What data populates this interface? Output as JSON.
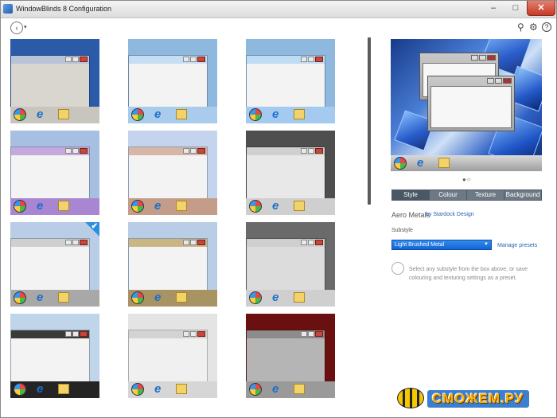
{
  "window": {
    "title": "WindowBlinds 8 Configuration",
    "min_glyph": "–",
    "max_glyph": "□",
    "close_glyph": "✕"
  },
  "toolbar": {
    "back_glyph": "‹",
    "back_caret": "▾",
    "search_glyph": "⚲",
    "settings_glyph": "⚙",
    "help_glyph": "?"
  },
  "skins": [
    {
      "name": "classic-blue",
      "cap": "#b7c3d6",
      "client": "#d9d6cf",
      "bg": "#2a5aa8",
      "bar": "#c8c5be",
      "selected": false
    },
    {
      "name": "aero-light-blue",
      "cap": "#c5def4",
      "client": "#f3f3f3",
      "bg": "#8fb8de",
      "bar": "#a9cbec",
      "selected": false
    },
    {
      "name": "aero-sky",
      "cap": "#bfdcf5",
      "client": "#f3f3f3",
      "bg": "#8fb8de",
      "bar": "#a4cbef",
      "selected": false
    },
    {
      "name": "aero-lilac",
      "cap": "#c5a8de",
      "client": "#f3f3f3",
      "bg": "#a7c0e2",
      "bar": "#a886d2",
      "selected": false
    },
    {
      "name": "aero-copper",
      "cap": "#d6b6a6",
      "client": "#f3f3f3",
      "bg": "#c4d4ec",
      "bar": "#c49c8a",
      "selected": false
    },
    {
      "name": "silver-round",
      "cap": "#d0d0d0",
      "client": "#e8e8e8",
      "bg": "#4e4e4e",
      "bar": "#cfcfcf",
      "selected": false
    },
    {
      "name": "aero-metals",
      "cap": "#cfcfcf",
      "client": "#f3f3f3",
      "bg": "#b9cde6",
      "bar": "#a8a8a8",
      "selected": true
    },
    {
      "name": "aero-gold",
      "cap": "#c9b684",
      "client": "#f3f3f3",
      "bg": "#b9cde6",
      "bar": "#a89462",
      "selected": false
    },
    {
      "name": "chrome-red",
      "cap": "#cfcfcf",
      "client": "#dcdcdc",
      "bg": "#6a6a6a",
      "bar": "#cfcfcf",
      "selected": false
    },
    {
      "name": "carbon-dark",
      "cap": "#3a3a3a",
      "client": "#f3f3f3",
      "bg": "#c0d4ea",
      "bar": "#242424",
      "selected": false
    },
    {
      "name": "plain-silver",
      "cap": "#d3d3d3",
      "client": "#f0f0f0",
      "bg": "#e4e4e4",
      "bar": "#d6d6d6",
      "selected": false
    },
    {
      "name": "crimson-steel",
      "cap": "#8c8c8c",
      "client": "#b5b5b5",
      "bg": "#6b1010",
      "bar": "#9a9a9a",
      "selected": false
    }
  ],
  "preview": {
    "dots": "●○"
  },
  "tabs": [
    "Style",
    "Colour",
    "Texture",
    "Background"
  ],
  "active_tab": "Style",
  "style": {
    "name": "Aero Metals",
    "by": "by Stardock Design"
  },
  "substyle": {
    "label": "Substyle",
    "value": "Light Brushed Metal",
    "arrow": "▼",
    "presets_link": "Manage presets",
    "hint": "Select any substyle from the box above, or save colouring and texturing settings as a preset.",
    "hint_glyph": "💡"
  },
  "watermark": {
    "text": "СМОЖЕМ.РУ"
  }
}
